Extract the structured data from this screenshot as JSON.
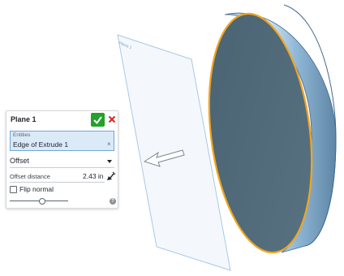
{
  "viewport": {
    "plane_tag": "Plane 1",
    "colors": {
      "plane_fill": "#f2f7fd",
      "plane_stroke": "#a9c7e8",
      "disk_face": "#4e6777",
      "disk_side": "#7fa8c8",
      "edge_highlight": "#f2a51f"
    }
  },
  "panel": {
    "title": "Plane 1",
    "accept_icon": "check-icon",
    "cancel_icon": "close-icon",
    "entities": {
      "label": "Entities",
      "value": "Edge of Extrude 1",
      "clear": "×"
    },
    "type_select": {
      "value": "Offset"
    },
    "offset": {
      "label": "Offset distance",
      "value": "2.43 in",
      "flip_icon": "flip-direction-arrow-icon"
    },
    "flip_normal": {
      "label": "Flip normal",
      "checked": false
    },
    "slider": {
      "level": 0.55
    },
    "help": "?"
  }
}
